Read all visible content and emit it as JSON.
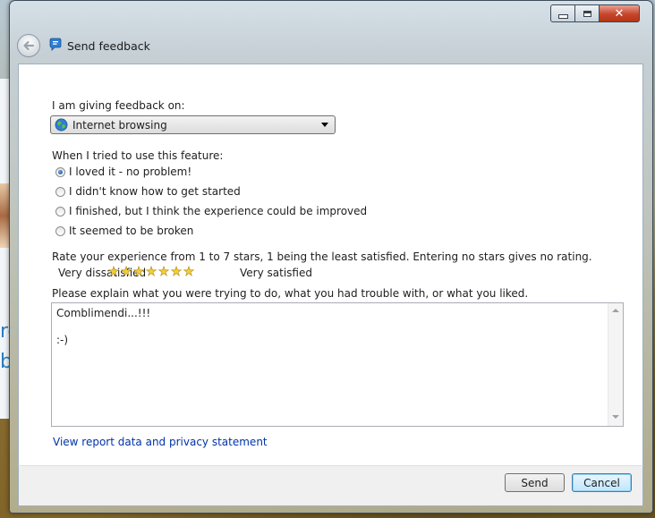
{
  "window": {
    "title": "Send feedback"
  },
  "background": {
    "letters": [
      "ro",
      "b"
    ]
  },
  "feedback_on": {
    "label": "I am giving feedback on:",
    "selected": "Internet browsing"
  },
  "experience": {
    "label": "When I tried to use this feature:",
    "options": [
      {
        "label": "I loved it - no problem!",
        "checked": true
      },
      {
        "label": "I didn't know how to get started",
        "checked": false
      },
      {
        "label": "I finished, but I think the experience could be improved",
        "checked": false
      },
      {
        "label": "It seemed to be broken",
        "checked": false
      }
    ]
  },
  "rating": {
    "instructions": "Rate your experience from 1 to 7 stars, 1 being the least satisfied.  Entering no stars gives no rating.",
    "low_label": "Very dissatisfied",
    "high_label": "Very satisfied",
    "stars_total": 7,
    "stars_selected": 7
  },
  "explanation": {
    "label": "Please explain what you were trying to do, what you had trouble with, or what you liked.",
    "value": "Comblimendi...!!!\n\n:-)"
  },
  "privacy_link": "View report data and privacy statement",
  "buttons": {
    "send": "Send",
    "cancel": "Cancel"
  },
  "colors": {
    "link": "#0033aa",
    "star": "#f3cf3a",
    "close_button": "#c7452b"
  }
}
